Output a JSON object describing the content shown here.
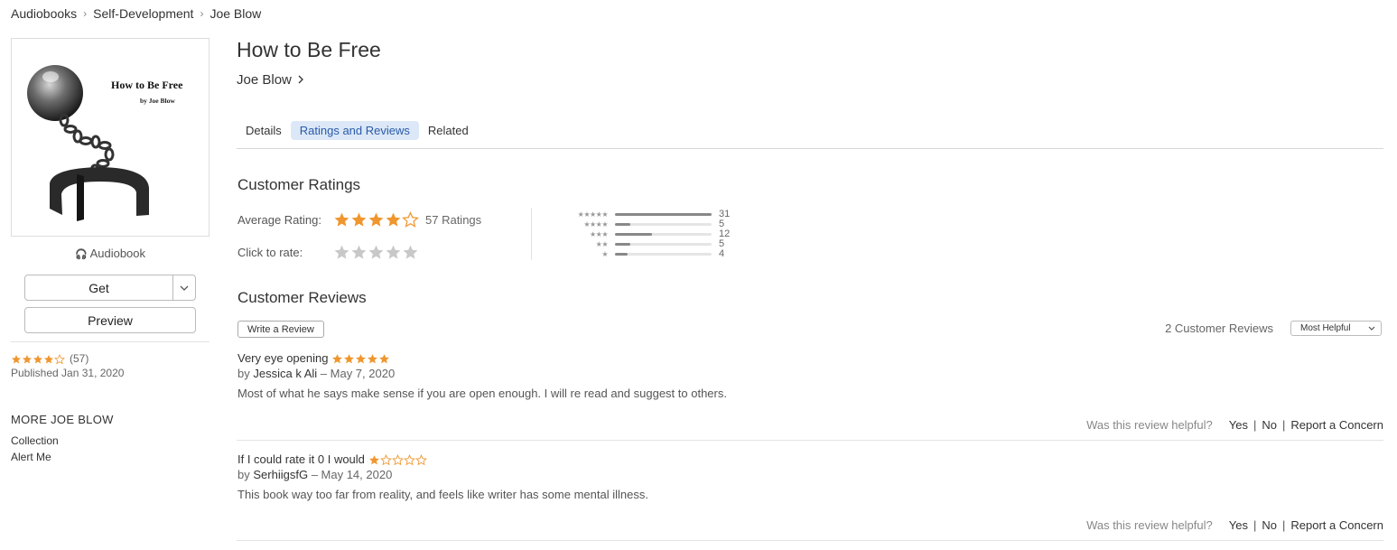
{
  "breadcrumb": [
    "Audiobooks",
    "Self-Development",
    "Joe Blow"
  ],
  "cover": {
    "title": "How to Be Free",
    "by": "by Joe Blow"
  },
  "sidebar": {
    "kind": "Audiobook",
    "get_label": "Get",
    "preview_label": "Preview",
    "rating_count": "(57)",
    "published": "Published Jan 31, 2020",
    "more_title": "MORE JOE BLOW",
    "more_links": [
      "Collection",
      "Alert Me"
    ]
  },
  "book": {
    "title": "How to Be Free",
    "author": "Joe Blow"
  },
  "tabs": [
    {
      "label": "Details",
      "active": false
    },
    {
      "label": "Ratings and Reviews",
      "active": true
    },
    {
      "label": "Related",
      "active": false
    }
  ],
  "ratings": {
    "heading": "Customer Ratings",
    "average_label": "Average Rating:",
    "average_value": 4,
    "count_label": "57 Ratings",
    "click_label": "Click to rate:",
    "histogram": [
      {
        "stars": "★★★★★",
        "count": "31",
        "value": 31
      },
      {
        "stars": "★★★★",
        "count": "5",
        "value": 5
      },
      {
        "stars": "★★★",
        "count": "12",
        "value": 12
      },
      {
        "stars": "★★",
        "count": "5",
        "value": 5
      },
      {
        "stars": "★",
        "count": "4",
        "value": 4
      }
    ]
  },
  "reviews": {
    "heading": "Customer Reviews",
    "write_label": "Write a Review",
    "count_label": "2 Customer Reviews",
    "sort_label": "Most Helpful",
    "helpful_prompt": "Was this review helpful?",
    "yes": "Yes",
    "no": "No",
    "report": "Report a Concern",
    "items": [
      {
        "title": "Very eye opening",
        "stars": 5,
        "by": "by",
        "author": "Jessica k Ali",
        "date": "– May 7, 2020",
        "body": "Most of what he says make sense if you are open enough. I will re read and suggest to others."
      },
      {
        "title": "If I could rate it 0 I would",
        "stars": 1,
        "by": "by",
        "author": "SerhiigsfG",
        "date": "– May 14, 2020",
        "body": "This book way too far from reality, and feels like writer has some mental illness."
      }
    ]
  },
  "colors": {
    "star": "#f0962e",
    "star_empty": "#c8c8c8",
    "tab_active_bg": "#dce8f7",
    "tab_active_text": "#2a5ba8"
  }
}
